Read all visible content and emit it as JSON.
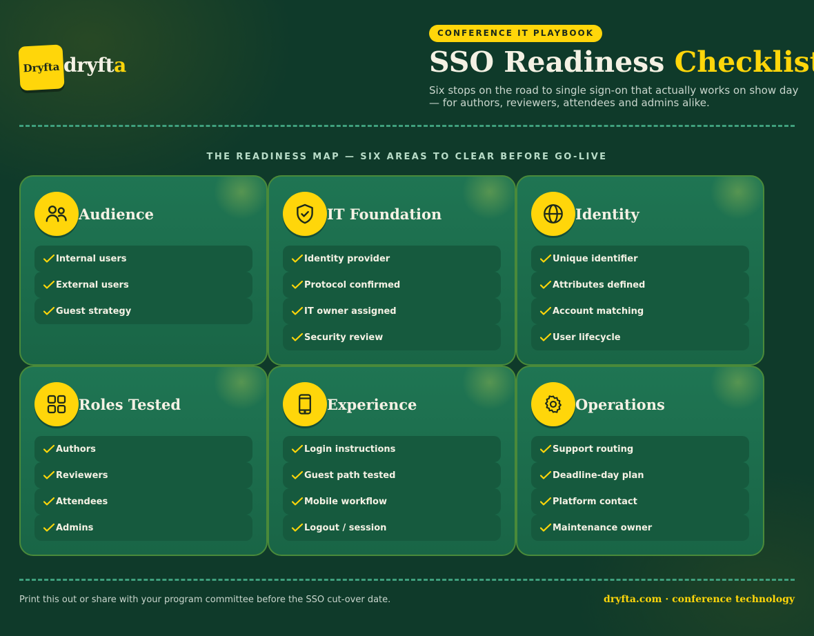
{
  "brand": {
    "badge_text": "Dryfta",
    "wordmark_main": "dryft",
    "wordmark_accent": "a"
  },
  "header": {
    "eyebrow": "CONFERENCE IT PLAYBOOK",
    "title_main": "SSO Readiness",
    "title_accent": "Checklist",
    "subtitle": "Six stops on the road to single sign-on that actually works on show day — for authors, reviewers, attendees and admins alike."
  },
  "section_title": "THE READINESS MAP — SIX AREAS TO CLEAR BEFORE GO-LIVE",
  "cards": [
    {
      "icon": "users-icon",
      "title": "Audience",
      "items": [
        "Internal users",
        "External users",
        "Guest strategy"
      ]
    },
    {
      "icon": "shield-check-icon",
      "title": "IT Foundation",
      "items": [
        "Identity provider",
        "Protocol confirmed",
        "IT owner assigned",
        "Security review"
      ]
    },
    {
      "icon": "globe-icon",
      "title": "Identity",
      "items": [
        "Unique identifier",
        "Attributes defined",
        "Account matching",
        "User lifecycle"
      ]
    },
    {
      "icon": "grid-icon",
      "title": "Roles Tested",
      "items": [
        "Authors",
        "Reviewers",
        "Attendees",
        "Admins"
      ]
    },
    {
      "icon": "smartphone-icon",
      "title": "Experience",
      "items": [
        "Login instructions",
        "Guest path tested",
        "Mobile workflow",
        "Logout / session"
      ]
    },
    {
      "icon": "gear-icon",
      "title": "Operations",
      "items": [
        "Support routing",
        "Deadline-day plan",
        "Platform contact",
        "Maintenance owner"
      ]
    }
  ],
  "footer": {
    "note": "Print this out or share with your program committee before the SSO cut-over date.",
    "link": "dryfta.com · conference technology"
  },
  "colors": {
    "accent": "#ffd60a",
    "background": "#0f3a2a",
    "card": "#1f7553",
    "item": "#165a3e"
  }
}
